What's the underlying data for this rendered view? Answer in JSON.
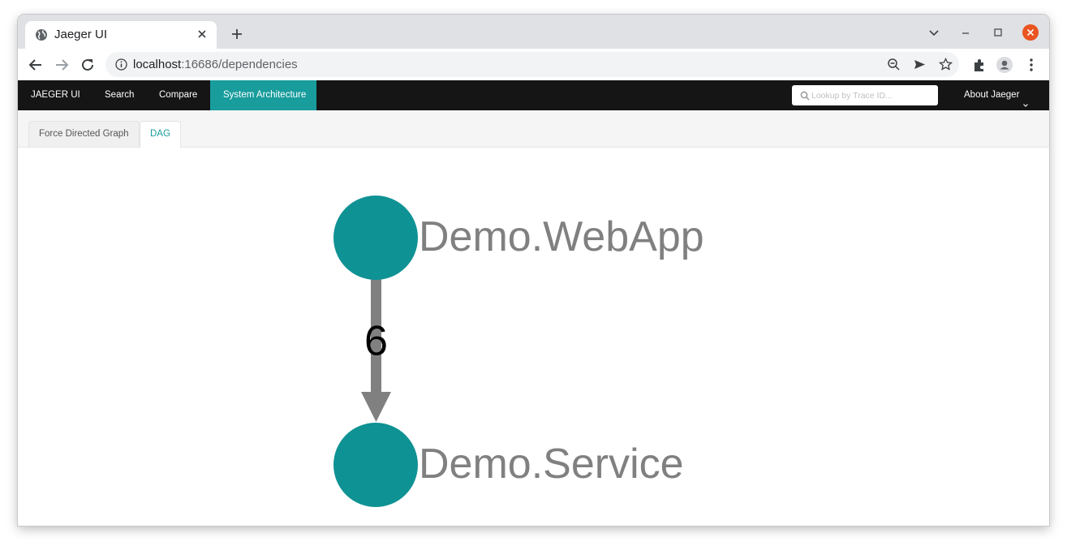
{
  "browser": {
    "tab_title": "Jaeger UI",
    "url_host": "localhost",
    "url_path": ":16686/dependencies"
  },
  "appnav": {
    "brand": "JAEGER UI",
    "items": [
      {
        "label": "Search"
      },
      {
        "label": "Compare"
      },
      {
        "label": "System Architecture",
        "active": true
      }
    ],
    "lookup_placeholder": "Lookup by Trace ID...",
    "about_label": "About Jaeger"
  },
  "subtabs": [
    {
      "label": "Force Directed Graph"
    },
    {
      "label": "DAG",
      "active": true
    }
  ],
  "dag": {
    "nodes": [
      {
        "label": "Demo.WebApp"
      },
      {
        "label": "Demo.Service"
      }
    ],
    "edges": [
      {
        "from": "Demo.WebApp",
        "to": "Demo.Service",
        "label": "6"
      }
    ],
    "node_color": "#0f9294",
    "edge_color": "#808080"
  },
  "colors": {
    "accent": "#199c9c",
    "nav_bg": "#151515",
    "close_button": "#e95420"
  }
}
